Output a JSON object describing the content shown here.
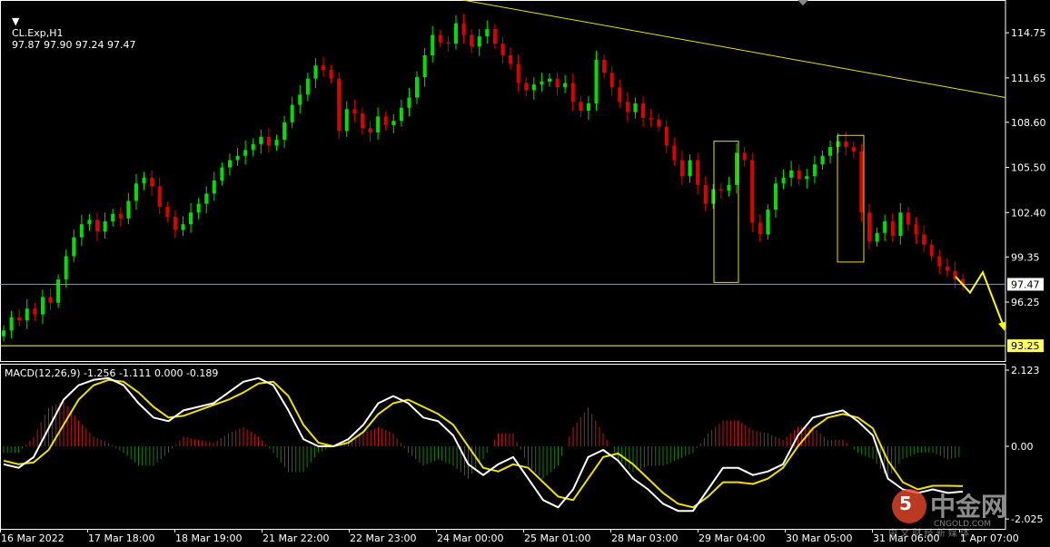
{
  "header": {
    "symbol_label": "CL.Exp,H1",
    "ohlc": "97.87 97.90 97.24 97.47",
    "macd_label": "MACD(12,26,9) -1.256 -1.111 0.000 -0.189"
  },
  "watermark": {
    "brand": "中金网",
    "url": "CNGOLD.COM",
    "tagline": "中 文 财 经 新 媒 体"
  },
  "colors": {
    "bg": "#000000",
    "bull": "#00e000",
    "bear": "#e00000",
    "trend": "#e6e000",
    "price_line": "#8a9bb0",
    "support": "#ffff66",
    "macd_line": "#ffffff",
    "signal_line": "#f0e000",
    "hist_pos": "#c01818",
    "hist_neg": "#1a7a1a",
    "grid_text": "#ffffff",
    "box": "#e6e000"
  },
  "chart_data": [
    {
      "type": "line",
      "name": "price",
      "x_labels": [
        "16 Mar 2022",
        "17 Mar 18:00",
        "18 Mar 19:00",
        "21 Mar 22:00",
        "22 Mar 23:00",
        "24 Mar 00:00",
        "25 Mar 01:00",
        "28 Mar 03:00",
        "29 Mar 04:00",
        "30 Mar 05:00",
        "31 Mar 06:00",
        "1 Apr 07:00"
      ],
      "y_ticks": [
        "114.75",
        "111.65",
        "108.60",
        "105.50",
        "102.40",
        "99.35",
        "96.25"
      ],
      "ylim": [
        92.2,
        117.0
      ],
      "current_price_label": "97.47",
      "current_price": 97.47,
      "support_label": "93.25",
      "support": 93.25,
      "trendline": [
        [
          0,
          118.5
        ],
        [
          106,
          110.3
        ]
      ],
      "boxes": [
        {
          "x": [
            0,
            0
          ],
          "y": [
            97.6,
            107.3
          ]
        },
        {
          "x": [
            0,
            0
          ],
          "y": [
            99.0,
            107.7
          ]
        }
      ],
      "forecast": [
        [
          98.0,
          96.9,
          98.3,
          94.4
        ]
      ],
      "closes": [
        94.3,
        95.2,
        95.0,
        95.8,
        95.4,
        96.6,
        96.2,
        97.8,
        99.4,
        100.7,
        101.6,
        101.9,
        101.1,
        101.8,
        102.3,
        102.0,
        103.2,
        104.4,
        104.8,
        104.2,
        102.8,
        102.1,
        101.2,
        101.6,
        102.4,
        103.0,
        103.7,
        104.6,
        105.5,
        106.0,
        106.3,
        106.7,
        107.1,
        107.6,
        107.0,
        107.4,
        108.6,
        109.8,
        110.5,
        111.6,
        112.5,
        112.2,
        111.6,
        108.0,
        109.5,
        109.2,
        108.2,
        107.9,
        109.0,
        108.4,
        108.7,
        109.6,
        110.3,
        111.7,
        113.2,
        114.6,
        114.1,
        114.0,
        115.4,
        114.6,
        113.8,
        114.5,
        115.0,
        114.0,
        113.2,
        112.6,
        111.3,
        110.8,
        111.2,
        111.4,
        111.6,
        111.0,
        111.3,
        110.0,
        109.4,
        109.9,
        112.9,
        112.0,
        111.0,
        110.0,
        109.3,
        109.9,
        108.9,
        108.8,
        108.3,
        107.0,
        106.0,
        104.9,
        106.0,
        104.3,
        103.0,
        104.0,
        103.9,
        104.3,
        106.5,
        106.0,
        101.7,
        100.9,
        102.6,
        104.4,
        104.8,
        105.3,
        104.7,
        104.9,
        105.7,
        106.3,
        106.9,
        107.3,
        106.9,
        106.6,
        102.4,
        100.4,
        101.0,
        101.8,
        100.8,
        102.4,
        101.6,
        100.9,
        100.2,
        99.4,
        98.7,
        98.4,
        97.8,
        97.47
      ]
    },
    {
      "type": "line",
      "name": "MACD(12,26,9)",
      "y_ticks": [
        "2.123",
        "0.00",
        "-2.025"
      ],
      "ylim": [
        -2.3,
        2.3
      ],
      "macd": [
        -0.5,
        -0.6,
        -0.3,
        0.5,
        1.3,
        1.7,
        1.85,
        1.9,
        1.7,
        1.2,
        0.8,
        0.7,
        1.0,
        1.1,
        1.2,
        1.5,
        1.8,
        1.9,
        1.7,
        1.0,
        0.2,
        0.0,
        0.0,
        0.2,
        0.6,
        1.2,
        1.4,
        1.2,
        0.8,
        0.7,
        0.3,
        -0.5,
        -0.8,
        -0.5,
        -0.3,
        -0.9,
        -1.5,
        -1.7,
        -1.2,
        -0.3,
        -0.1,
        -0.4,
        -0.9,
        -1.2,
        -1.6,
        -1.8,
        -1.8,
        -1.2,
        -0.6,
        -0.6,
        -0.8,
        -0.7,
        -0.5,
        0.3,
        0.8,
        0.9,
        1.0,
        0.7,
        0.3,
        -0.9,
        -1.2,
        -1.3,
        -1.2,
        -1.3,
        -1.26
      ],
      "signal": [
        -0.4,
        -0.5,
        -0.45,
        -0.1,
        0.6,
        1.3,
        1.7,
        1.85,
        1.8,
        1.5,
        1.1,
        0.8,
        0.85,
        1.0,
        1.15,
        1.3,
        1.5,
        1.75,
        1.8,
        1.4,
        0.6,
        0.1,
        0.0,
        0.1,
        0.4,
        0.9,
        1.2,
        1.3,
        1.1,
        0.9,
        0.6,
        0.0,
        -0.6,
        -0.7,
        -0.5,
        -0.6,
        -1.0,
        -1.4,
        -1.5,
        -0.9,
        -0.3,
        -0.2,
        -0.5,
        -0.9,
        -1.3,
        -1.6,
        -1.7,
        -1.4,
        -1.0,
        -1.0,
        -1.05,
        -0.9,
        -0.6,
        0.0,
        0.5,
        0.8,
        0.9,
        0.8,
        0.5,
        -0.4,
        -1.0,
        -1.2,
        -1.1,
        -1.1,
        -1.11
      ]
    }
  ]
}
